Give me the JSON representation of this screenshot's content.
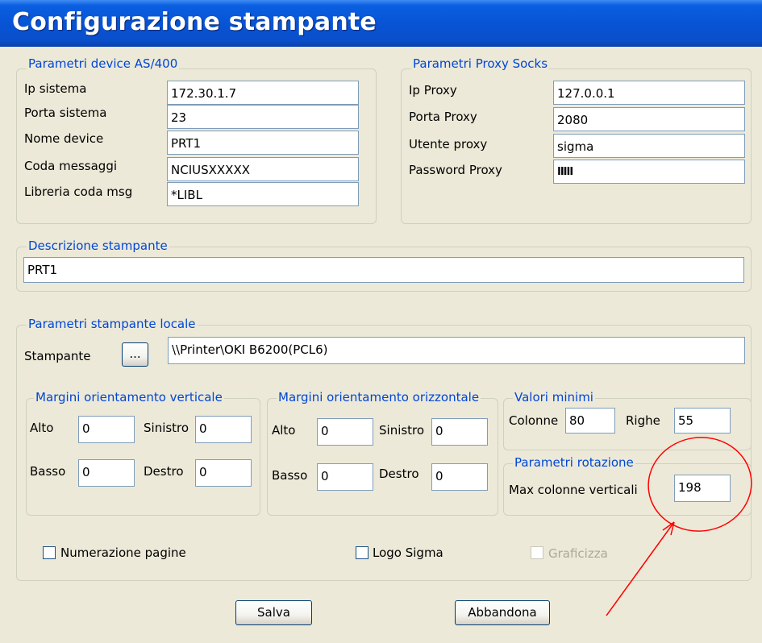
{
  "window": {
    "title": "Configurazione stampante"
  },
  "as400": {
    "legend": "Parametri device AS/400",
    "fields": [
      {
        "label": "Ip sistema",
        "value": "172.30.1.7"
      },
      {
        "label": "Porta sistema",
        "value": "23"
      },
      {
        "label": "Nome device",
        "value": "PRT1"
      },
      {
        "label": "Coda messaggi",
        "value": "NCIUSXXXXX"
      },
      {
        "label": "Libreria coda msg",
        "value": "*LIBL"
      }
    ]
  },
  "proxy": {
    "legend": "Parametri Proxy Socks",
    "fields": [
      {
        "label": "Ip Proxy",
        "value": "127.0.0.1"
      },
      {
        "label": "Porta Proxy",
        "value": "2080"
      },
      {
        "label": "Utente proxy",
        "value": "sigma"
      },
      {
        "label": "Password Proxy",
        "value": "IIIII"
      }
    ]
  },
  "descrizione": {
    "legend": "Descrizione stampante",
    "value": "PRT1"
  },
  "locale": {
    "legend": "Parametri stampante locale",
    "printer_label": "Stampante",
    "browse_label": "...",
    "printer_value": "\\\\Printer\\OKI B6200(PCL6)"
  },
  "verticale": {
    "legend": "Margini orientamento verticale",
    "alto_label": "Alto",
    "alto": "0",
    "sinistro_label": "Sinistro",
    "sinistro": "0",
    "basso_label": "Basso",
    "basso": "0",
    "destro_label": "Destro",
    "destro": "0"
  },
  "orizzontale": {
    "legend": "Margini orientamento orizzontale",
    "alto_label": "Alto",
    "alto": "0",
    "sinistro_label": "Sinistro",
    "sinistro": "0",
    "basso_label": "Basso",
    "basso": "0",
    "destro_label": "Destro",
    "destro": "0"
  },
  "minimi": {
    "legend": "Valori minimi",
    "colonne_label": "Colonne",
    "colonne": "80",
    "righe_label": "Righe",
    "righe": "55"
  },
  "rotazione": {
    "legend": "Parametri rotazione",
    "max_label": "Max colonne verticali",
    "max": "198"
  },
  "options": {
    "numerazione": {
      "label": "Numerazione pagine",
      "checked": false
    },
    "logo": {
      "label": "Logo Sigma",
      "checked": false
    },
    "graficizza": {
      "label": "Graficizza",
      "checked": false,
      "disabled": true
    }
  },
  "buttons": {
    "save": "Salva",
    "cancel": "Abbandona"
  },
  "colors": {
    "titlebar": "#0854D6",
    "legend": "#0046D5",
    "annotation": "#FF0000",
    "background": "#ECE9D8"
  },
  "icons": {
    "annotation": "red-circle-and-arrow"
  }
}
